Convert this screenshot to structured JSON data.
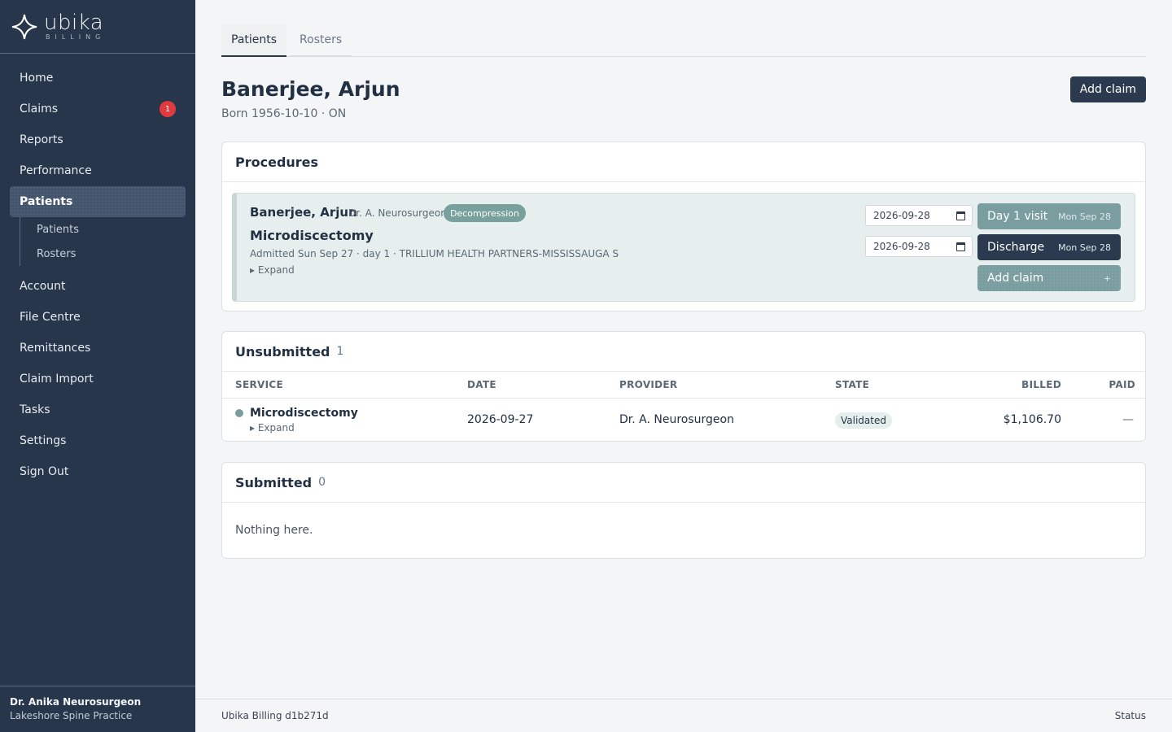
{
  "brand": {
    "name": "ubika",
    "sub": "BILLING"
  },
  "nav": {
    "home": "Home",
    "claims": "Claims",
    "claims_badge": "1",
    "reports": "Reports",
    "performance": "Performance",
    "patients": "Patients",
    "sub_patients": "Patients",
    "sub_rosters": "Rosters",
    "account": "Account",
    "file_centre": "File Centre",
    "remittances": "Remittances",
    "claim_import": "Claim Import",
    "tasks": "Tasks",
    "settings": "Settings",
    "sign_out": "Sign Out"
  },
  "user": {
    "name": "Dr. Anika Neurosurgeon",
    "practice": "Lakeshore Spine Practice"
  },
  "tabs": {
    "patients": "Patients",
    "rosters": "Rosters"
  },
  "patient": {
    "name": "Banerjee, Arjun",
    "born": "Born 1956-10-10 · ON",
    "add_claim": "Add claim"
  },
  "procedures": {
    "heading": "Procedures",
    "item": {
      "patient": "Banerjee, Arjun",
      "doctor": "Dr. A. Neurosurgeon",
      "tag": "Decompression",
      "title": "Microdiscectomy",
      "meta": "Admitted Sun Sep 27 · day 1 · TRILLIUM HEALTH PARTNERS-MISSISSAUGA S",
      "expand": "▸ Expand",
      "date1": "2026-09-28",
      "date2": "2026-09-28",
      "day1_label": "Day 1 visit",
      "day1_date": "Mon Sep 28",
      "discharge_label": "Discharge",
      "discharge_date": "Mon Sep 28",
      "add_claim_label": "Add claim",
      "add_claim_plus": "+"
    }
  },
  "unsubmitted": {
    "heading": "Unsubmitted",
    "count": "1",
    "columns": {
      "service": "SERVICE",
      "date": "DATE",
      "provider": "PROVIDER",
      "state": "STATE",
      "billed": "BILLED",
      "paid": "PAID"
    },
    "rows": [
      {
        "service": "Microdiscectomy",
        "expand": "▸ Expand",
        "date": "2026-09-27",
        "provider": "Dr. A. Neurosurgeon",
        "state": "Validated",
        "billed": "$1,106.70",
        "paid": "—"
      }
    ]
  },
  "submitted": {
    "heading": "Submitted",
    "count": "0",
    "empty": "Nothing here."
  },
  "footer": {
    "left": "Ubika Billing d1b271d",
    "right": "Status"
  }
}
